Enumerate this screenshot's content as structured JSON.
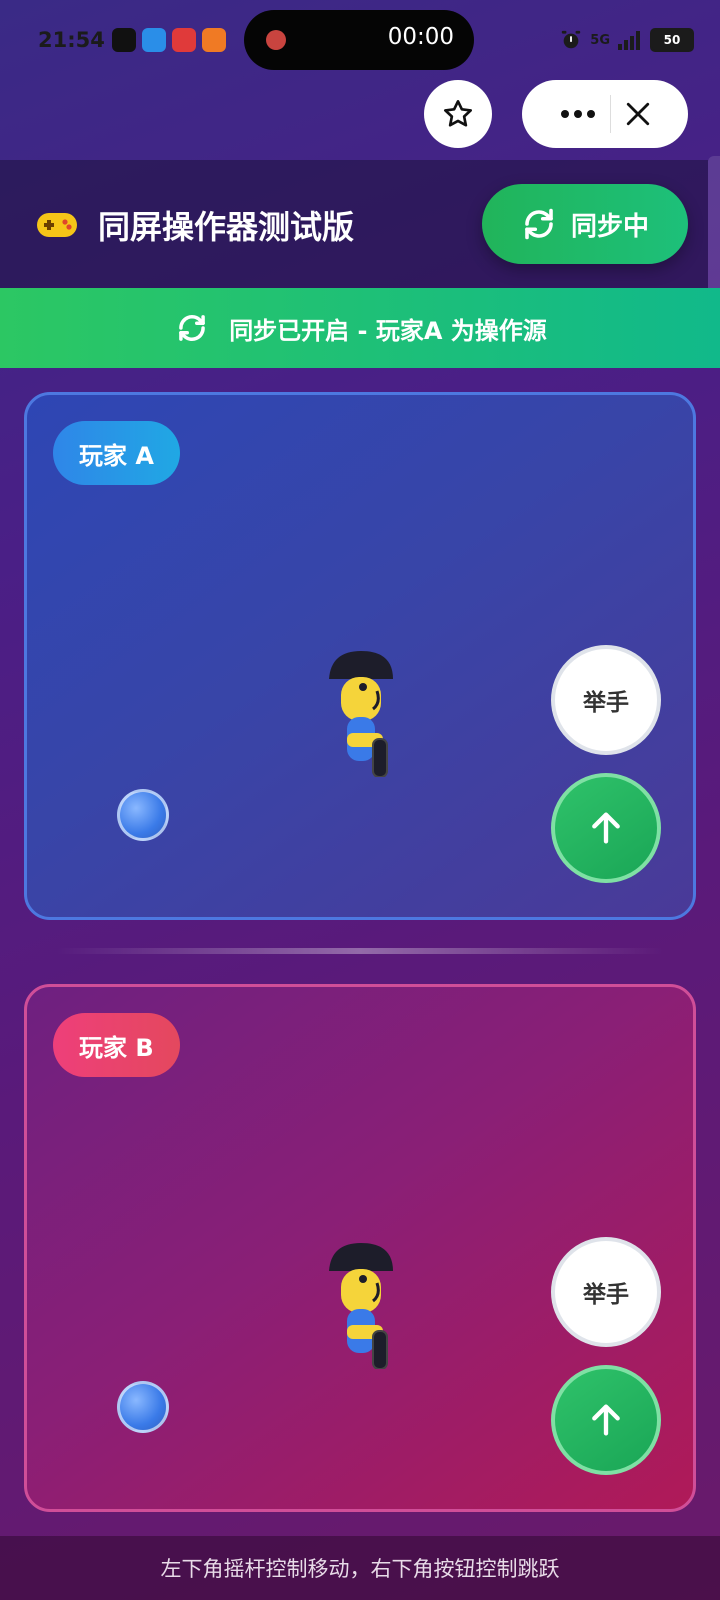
{
  "status_bar": {
    "time": "21:54",
    "recording_time": "00:00",
    "network": "5G",
    "battery": "50"
  },
  "mini_program": {
    "favorite_icon": "star-icon",
    "more_icon": "more-icon",
    "close_icon": "close-icon"
  },
  "header": {
    "icon": "gamepad-icon",
    "title": "同屏操作器测试版",
    "sync_button": "同步中"
  },
  "banner": {
    "text": "同步已开启 - 玩家A 为操作源"
  },
  "players": [
    {
      "tag": "玩家 A",
      "raise_hand": "举手"
    },
    {
      "tag": "玩家 B",
      "raise_hand": "举手"
    }
  ],
  "footer": {
    "hint": "左下角摇杆控制移动，右下角按钮控制跳跃"
  },
  "colors": {
    "sync_green": "#21b45a",
    "player_a": "#2f86e8",
    "player_b": "#ee3f7a"
  }
}
